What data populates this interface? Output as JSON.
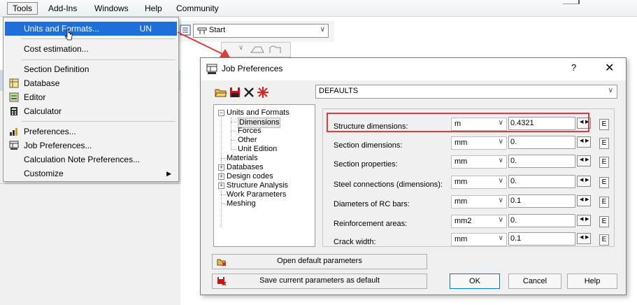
{
  "menubar": {
    "items": [
      {
        "label": "Tools",
        "active": true
      },
      {
        "label": "Add-Ins"
      },
      {
        "label": "Windows"
      },
      {
        "label": "Help"
      },
      {
        "label": "Community"
      }
    ]
  },
  "toolbar": {
    "start_combo": "Start"
  },
  "tools_menu": {
    "items": [
      {
        "label": "Units and Formats...",
        "shortcut": "UN",
        "highlighted": true
      },
      {
        "label": "Cost estimation..."
      },
      {
        "label": "Section Definition"
      },
      {
        "label": "Database"
      },
      {
        "label": "Editor"
      },
      {
        "label": "Calculator"
      },
      {
        "label": "Preferences..."
      },
      {
        "label": "Job Preferences..."
      },
      {
        "label": "Calculation Note Preferences..."
      },
      {
        "label": "Customize",
        "submenu": true
      }
    ]
  },
  "dialog": {
    "title": "Job Preferences",
    "help_glyph": "?",
    "close_glyph": "✕",
    "preset": "DEFAULTS",
    "tree": [
      {
        "label": "Units and Formats",
        "expanded": true
      },
      {
        "label": "Dimensions",
        "selected": true
      },
      {
        "label": "Forces"
      },
      {
        "label": "Other"
      },
      {
        "label": "Unit Edition"
      },
      {
        "label": "Materials"
      },
      {
        "label": "Databases",
        "expandable": true
      },
      {
        "label": "Design codes",
        "expandable": true
      },
      {
        "label": "Structure Analysis",
        "expandable": true
      },
      {
        "label": "Work Parameters"
      },
      {
        "label": "Meshing"
      }
    ],
    "fields": [
      {
        "label": "Structure dimensions:",
        "unit": "m",
        "value": "0.4321",
        "highlighted": true
      },
      {
        "label": "Section dimensions:",
        "unit": "mm",
        "value": "0."
      },
      {
        "label": "Section properties:",
        "unit": "mm",
        "value": "0."
      },
      {
        "label": "Steel connections (dimensions):",
        "unit": "mm",
        "value": "0."
      },
      {
        "label": "Diameters of RC bars:",
        "unit": "mm",
        "value": "0.1"
      },
      {
        "label": "Reinforcement areas:",
        "unit": "mm2",
        "value": "0."
      },
      {
        "label": "Crack width:",
        "unit": "mm",
        "value": "0.1"
      }
    ],
    "edit_button": "E",
    "buttons": {
      "open_default": "Open default parameters",
      "save_default": "Save current parameters as default",
      "ok": "OK",
      "cancel": "Cancel",
      "help": "Help"
    }
  },
  "colors": {
    "menu_highlight": "#1e6fd9",
    "callout": "#e23b3b",
    "dialog_bg": "#f0f0f0"
  }
}
